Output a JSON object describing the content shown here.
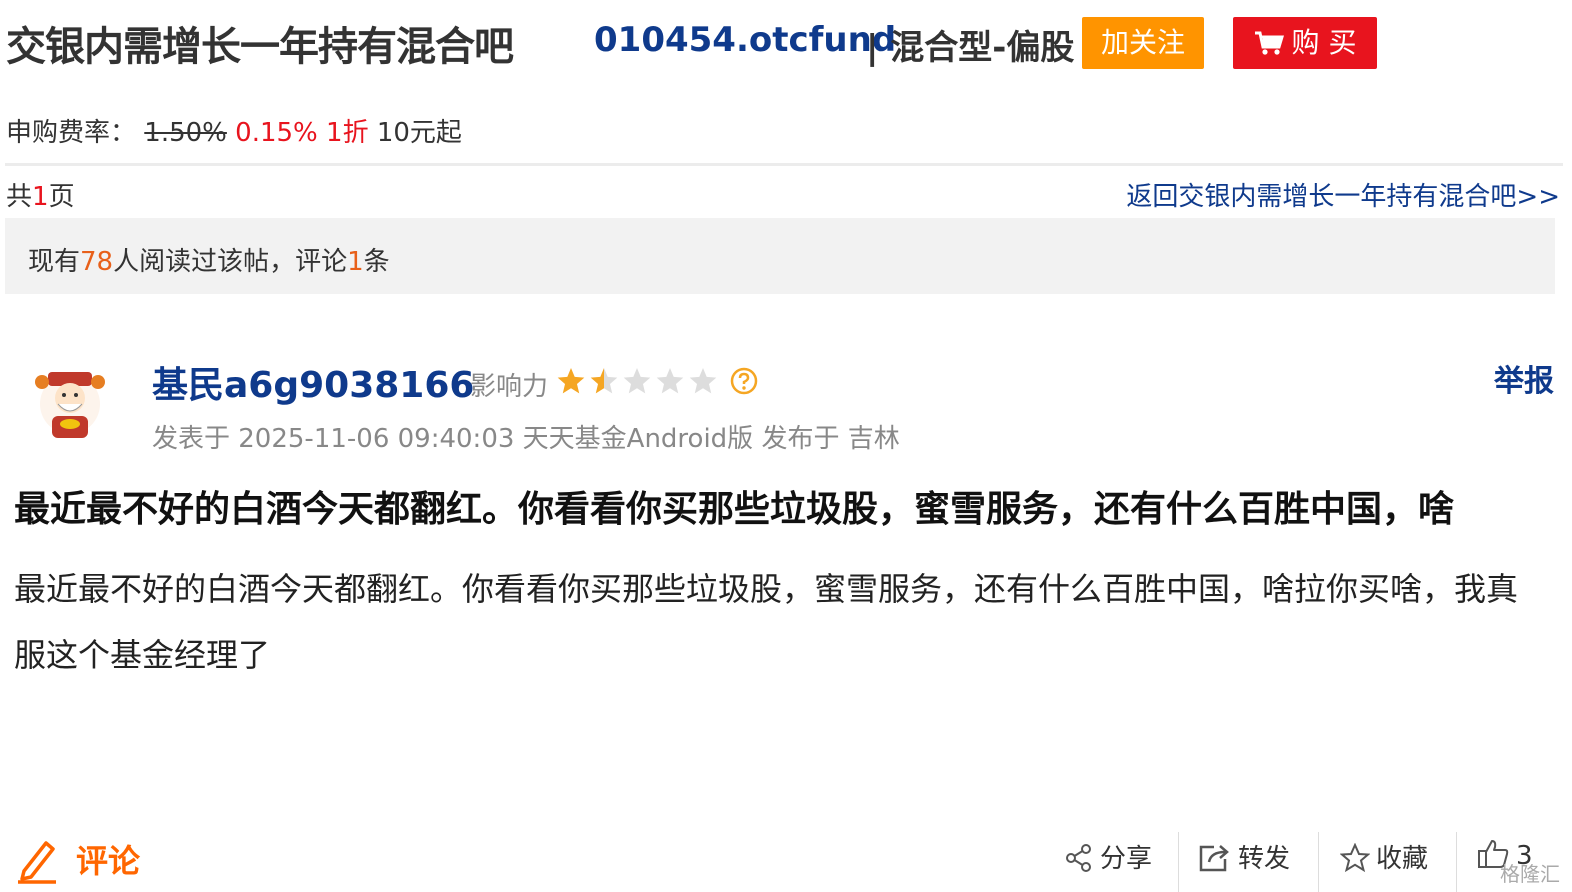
{
  "header": {
    "bar_title": "交银内需增长一年持有混合吧",
    "fund_code": "010454.otcfund",
    "fund_type": "| 混合型-偏股",
    "follow_label": "加关注",
    "buy_label": "购 买"
  },
  "fee": {
    "label": "申购费率：",
    "original_rate": "1.50%",
    "discount_rate": "0.15%",
    "discount": "1折",
    "min_amount": "10元起"
  },
  "pagination": {
    "prefix": "共",
    "pages": "1",
    "suffix": "页",
    "back_link": "返回交银内需增长一年持有混合吧>>"
  },
  "stats": {
    "prefix": "现有",
    "readers": "78",
    "middle": "人阅读过该帖，评论",
    "comments": "1",
    "suffix": "条"
  },
  "post": {
    "username": "基民a6g9038166",
    "influence_label": "影响力",
    "influence_rating": 1.5,
    "influence_max": 5,
    "report_label": "举报",
    "meta": "发表于 2025-11-06 09:40:03 天天基金Android版 发布于 吉林",
    "title": "最近最不好的白酒今天都翻红。你看看你买那些垃圾股，蜜雪服务，还有什么百胜中国，啥",
    "body": "最近最不好的白酒今天都翻红。你看看你买那些垃圾股，蜜雪服务，还有什么百胜中国，啥拉你买啥，我真服这个基金经理了"
  },
  "footer": {
    "comment_label": "评论",
    "share_label": "分享",
    "forward_label": "转发",
    "favorite_label": "收藏",
    "like_count": "3"
  },
  "watermark": "格隆汇",
  "colors": {
    "link_blue": "#0f3a8c",
    "follow_orange": "#ff9400",
    "buy_red": "#e8141e",
    "comment_orange": "#ff6600",
    "star_gold": "#f5a623"
  },
  "icons": [
    "cart-icon",
    "star-icon",
    "help-icon",
    "pencil-icon",
    "share-icon",
    "forward-icon",
    "favorite-star-icon",
    "thumbs-up-icon"
  ]
}
